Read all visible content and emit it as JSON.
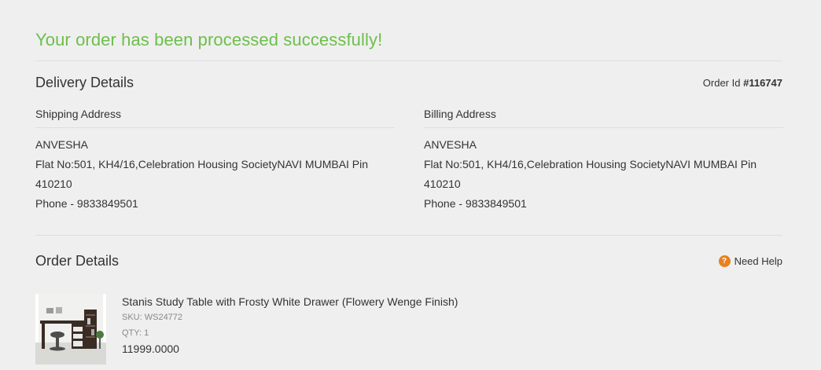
{
  "success_message": "Your order has been processed successfully!",
  "delivery": {
    "title": "Delivery Details",
    "order_id_label": "Order Id",
    "order_id_value": "#116747"
  },
  "shipping": {
    "heading": "Shipping Address",
    "name": "ANVESHA",
    "address": "Flat No:501, KH4/16,Celebration Housing SocietyNAVI MUMBAI Pin 410210",
    "phone": "Phone - 9833849501"
  },
  "billing": {
    "heading": "Billing Address",
    "name": "ANVESHA",
    "address": "Flat No:501, KH4/16,Celebration Housing SocietyNAVI MUMBAI Pin 410210",
    "phone": "Phone - 9833849501"
  },
  "order": {
    "title": "Order Details",
    "help_label": "Need Help",
    "help_icon_text": "?",
    "product": {
      "name": "Stanis Study Table with Frosty White Drawer (Flowery Wenge Finish)",
      "sku": "SKU: WS24772",
      "qty": "QTY: 1",
      "price": "11999.0000"
    }
  },
  "colors": {
    "success": "#6dbf4b",
    "help_icon": "#e8801e",
    "background": "#efefef"
  }
}
